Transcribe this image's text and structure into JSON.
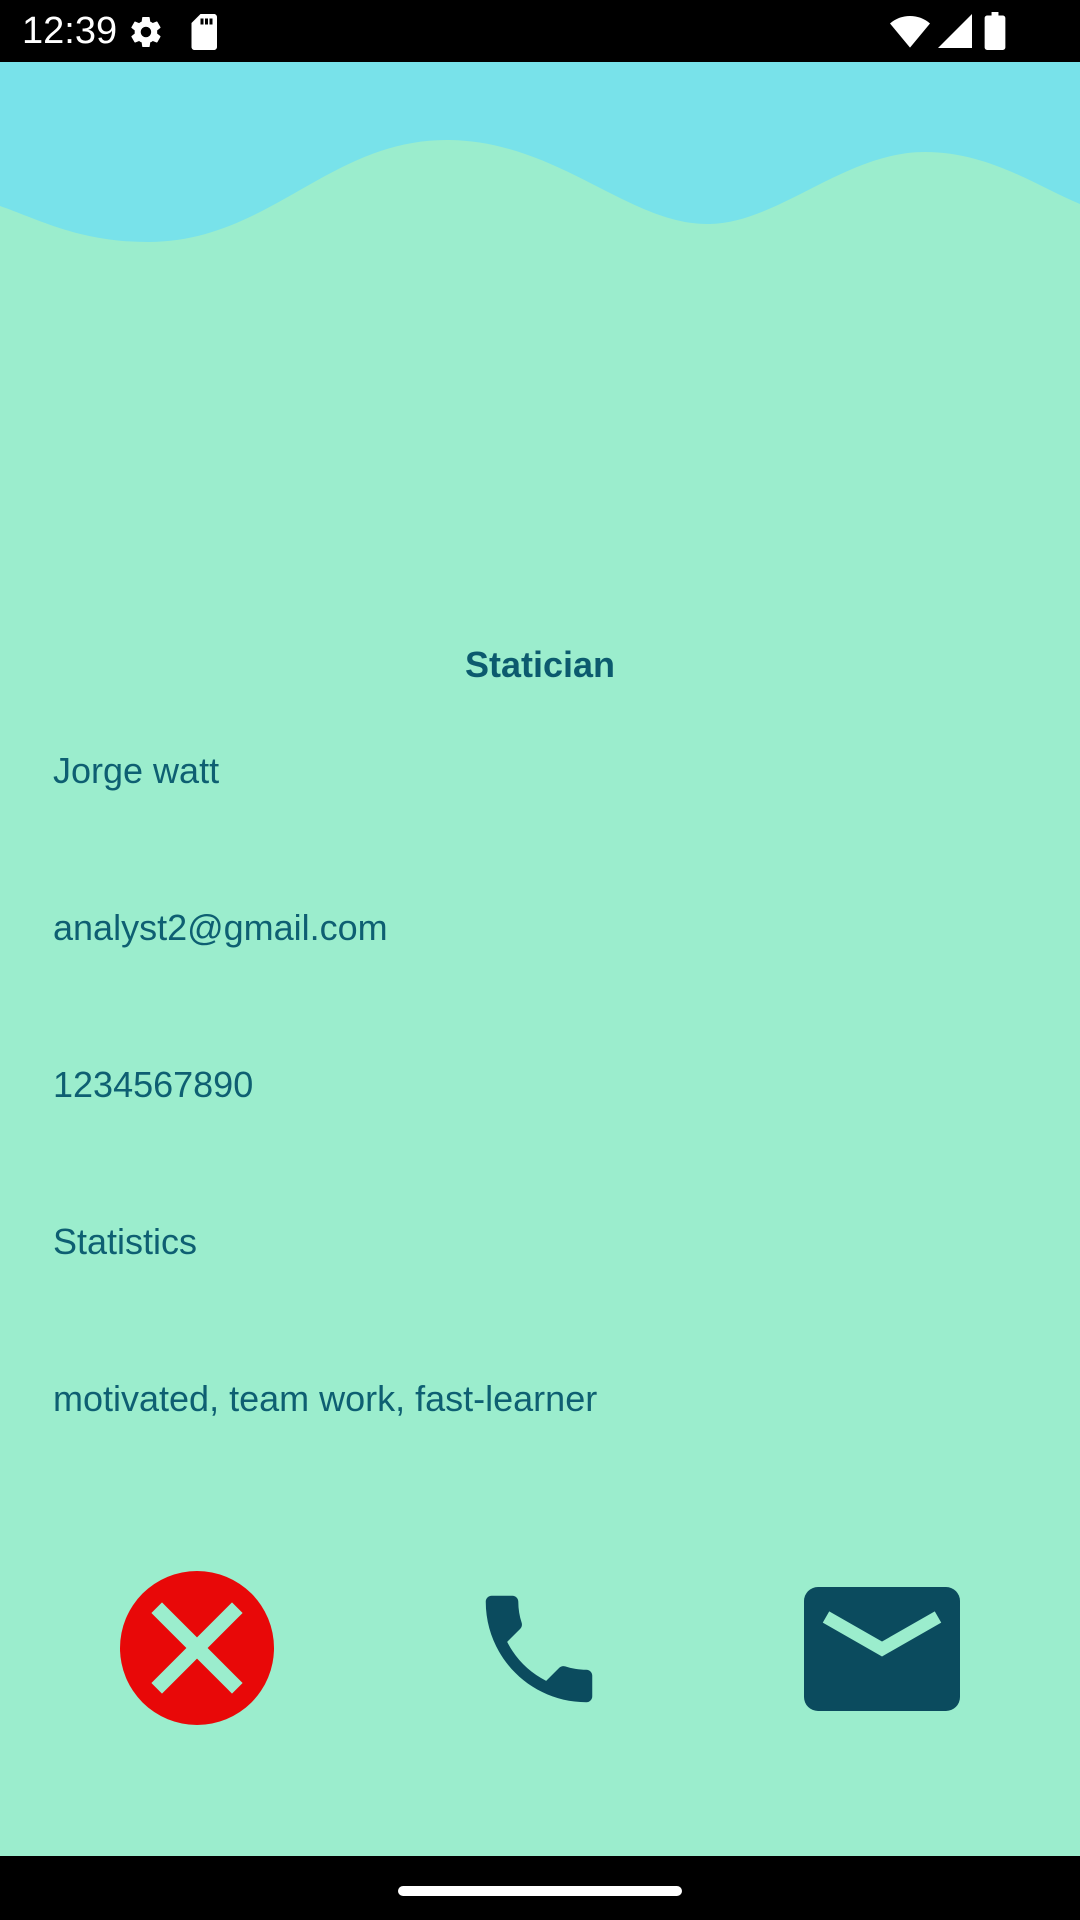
{
  "status_bar": {
    "time": "12:39",
    "left_icons": [
      "settings-icon",
      "sd-card-icon"
    ],
    "right_icons": [
      "wifi-icon",
      "cell-signal-icon",
      "battery-icon"
    ]
  },
  "profile": {
    "title": "Statician",
    "name": "Jorge watt",
    "email": "analyst2@gmail.com",
    "phone": "1234567890",
    "department": "Statistics",
    "skills": "motivated, team work, fast-learner"
  },
  "actions": {
    "close_icon": "close-icon",
    "call_icon": "phone-icon",
    "email_icon": "mail-icon"
  },
  "colors": {
    "background": "#9BEDCD",
    "wave": "#78E2EA",
    "text": "#0E5F72",
    "icon_dark": "#0B4B5E",
    "close_red": "#E80808"
  }
}
